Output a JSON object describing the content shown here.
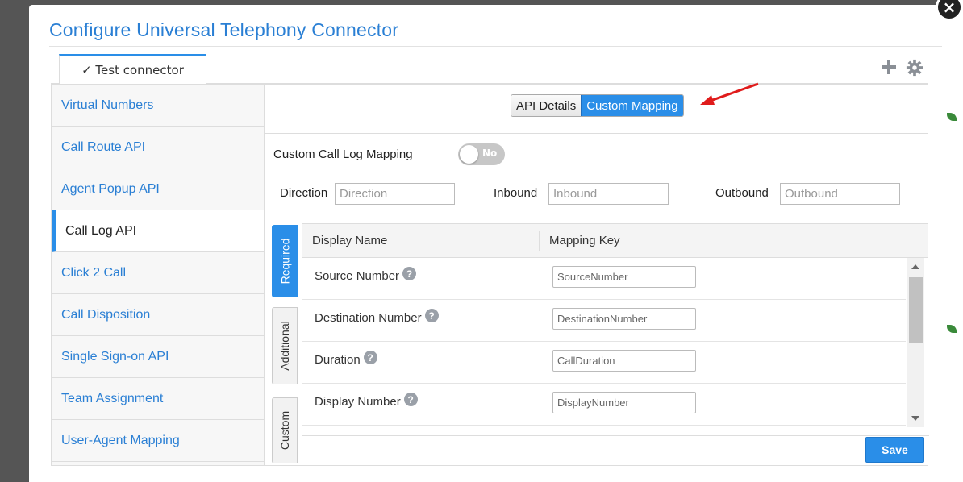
{
  "window": {
    "title": "Configure Universal Telephony Connector",
    "close_symbol": "×"
  },
  "connector_tab": {
    "label": "✓ Test connector"
  },
  "toolbar": {
    "add_icon": "plus-icon",
    "settings_icon": "gear-icon"
  },
  "sidebar": {
    "items": [
      {
        "label": "Virtual Numbers",
        "active": false
      },
      {
        "label": "Call Route API",
        "active": false
      },
      {
        "label": "Agent Popup API",
        "active": false
      },
      {
        "label": "Call Log API",
        "active": true
      },
      {
        "label": "Click 2 Call",
        "active": false
      },
      {
        "label": "Call Disposition",
        "active": false
      },
      {
        "label": "Single Sign-on API",
        "active": false
      },
      {
        "label": "Team Assignment",
        "active": false
      },
      {
        "label": "User-Agent Mapping",
        "active": false
      }
    ]
  },
  "segmented": {
    "api_details": "API Details",
    "custom_mapping": "Custom Mapping",
    "selected": "Custom Mapping"
  },
  "custom_call_log": {
    "label": "Custom Call Log Mapping",
    "toggle_text": "No"
  },
  "direction_fields": {
    "direction": {
      "label": "Direction",
      "placeholder": "Direction"
    },
    "inbound": {
      "label": "Inbound",
      "placeholder": "Inbound"
    },
    "outbound": {
      "label": "Outbound",
      "placeholder": "Outbound"
    }
  },
  "vertical_tabs": {
    "required": "Required",
    "additional": "Additional",
    "custom": "Custom",
    "selected": "Required"
  },
  "mapping_table": {
    "col_display_name": "Display Name",
    "col_mapping_key": "Mapping Key",
    "rows": [
      {
        "name": "Source Number",
        "placeholder": "SourceNumber"
      },
      {
        "name": "Destination Number",
        "placeholder": "DestinationNumber"
      },
      {
        "name": "Duration",
        "placeholder": "CallDuration"
      },
      {
        "name": "Display Number",
        "placeholder": "DisplayNumber"
      }
    ],
    "help_symbol": "?"
  },
  "actions": {
    "save_label": "Save"
  },
  "colors": {
    "accent": "#2a8ee8",
    "title": "#2a7fd4",
    "arrow": "#e01b1b"
  }
}
